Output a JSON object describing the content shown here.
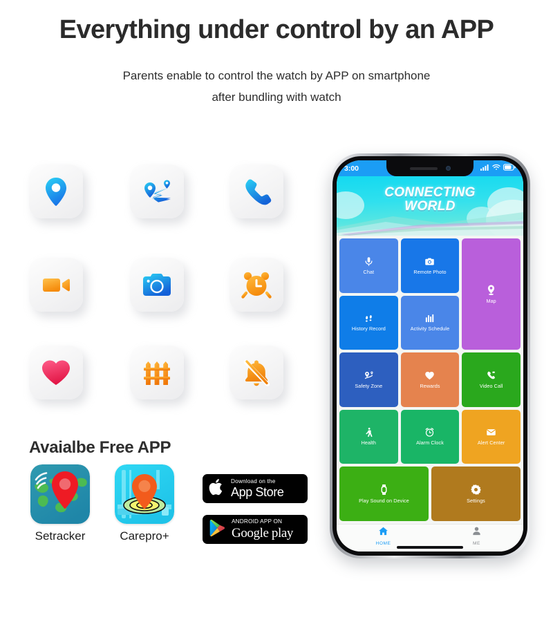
{
  "header": {
    "headline": "Everything under control by an APP",
    "subline_1": "Parents enable to control the watch by APP on smartphone",
    "subline_2": "after bundling with watch"
  },
  "feature_icons": [
    {
      "name": "location-pin-icon",
      "label": "Location"
    },
    {
      "name": "route-map-icon",
      "label": "Route Track"
    },
    {
      "name": "phone-call-icon",
      "label": "Voice Call"
    },
    {
      "name": "video-camera-icon",
      "label": "Video Call"
    },
    {
      "name": "camera-icon",
      "label": "Remote Camera"
    },
    {
      "name": "alarm-clock-icon",
      "label": "Alarm"
    },
    {
      "name": "heart-icon",
      "label": "Health"
    },
    {
      "name": "fence-icon",
      "label": "Safety Fence"
    },
    {
      "name": "bell-off-icon",
      "label": "Class Silence"
    }
  ],
  "available_app": {
    "title": "Avaialbe Free APP",
    "apps": [
      {
        "name": "setracker",
        "caption": "Setracker"
      },
      {
        "name": "carepro",
        "caption": "Carepro+"
      }
    ],
    "badges": [
      {
        "name": "app-store",
        "small": "Download on the",
        "big": "App Store"
      },
      {
        "name": "google-play",
        "small": "ANDROID APP ON",
        "big": "Google play"
      }
    ]
  },
  "phone": {
    "status_bar": {
      "time": "3:00",
      "signal": "signal-icon",
      "wifi": "wifi-icon",
      "battery": "battery-icon"
    },
    "banner": {
      "line_1": "CONNECTING",
      "line_2": "WORLD"
    },
    "tiles": [
      {
        "label": "Chat",
        "icon": "microphone-icon",
        "color": "#4a86e8",
        "col": "span 2",
        "row": "span 1"
      },
      {
        "label": "Remote Photo",
        "icon": "camera-icon",
        "color": "#1877e8",
        "col": "span 2",
        "row": "span 1"
      },
      {
        "label": "Map",
        "icon": "map-pin-icon",
        "color": "#b95fdb",
        "col": "span 2",
        "row": "span 2"
      },
      {
        "label": "History Record",
        "icon": "footsteps-icon",
        "color": "#0f7de8",
        "col": "span 2",
        "row": "span 1"
      },
      {
        "label": "Activity Schedule",
        "icon": "bar-chart-icon",
        "color": "#4a86e8",
        "col": "span 2",
        "row": "span 1"
      },
      {
        "label": "Safety Zone",
        "icon": "geofence-icon",
        "color": "#2d5fbf",
        "col": "span 2",
        "row": "span 1"
      },
      {
        "label": "Rewards",
        "icon": "heart-icon",
        "color": "#e5834e",
        "col": "span 2",
        "row": "span 1"
      },
      {
        "label": "Video Call",
        "icon": "video-call-icon",
        "color": "#2aa81d",
        "col": "span 2",
        "row": "span 1"
      },
      {
        "label": "Health",
        "icon": "walking-icon",
        "color": "#1eb467",
        "col": "span 2",
        "row": "span 1"
      },
      {
        "label": "Alarm Clock",
        "icon": "alarm-clock-icon",
        "color": "#19b566",
        "col": "span 2",
        "row": "span 1"
      },
      {
        "label": "Alert Center",
        "icon": "envelope-icon",
        "color": "#efa421",
        "col": "span 2",
        "row": "span 1"
      },
      {
        "label": "Play Sound on Device",
        "icon": "watch-icon",
        "color": "#3caf14",
        "col": "span 3",
        "row": "span 1"
      },
      {
        "label": "Settings",
        "icon": "gear-icon",
        "color": "#b07a1e",
        "col": "span 3",
        "row": "span 1"
      }
    ],
    "tabs": [
      {
        "label": "HOME",
        "icon": "home-icon",
        "active": true
      },
      {
        "label": "ME",
        "icon": "person-icon",
        "active": false
      }
    ]
  },
  "colors": {
    "headline": "#2b2b2b",
    "status_bar": "#1b9df5",
    "banner_start": "#14d9f0",
    "banner_end": "#93eee0",
    "tab_active": "#1b9df5",
    "tab_inactive": "#8b8f93"
  }
}
